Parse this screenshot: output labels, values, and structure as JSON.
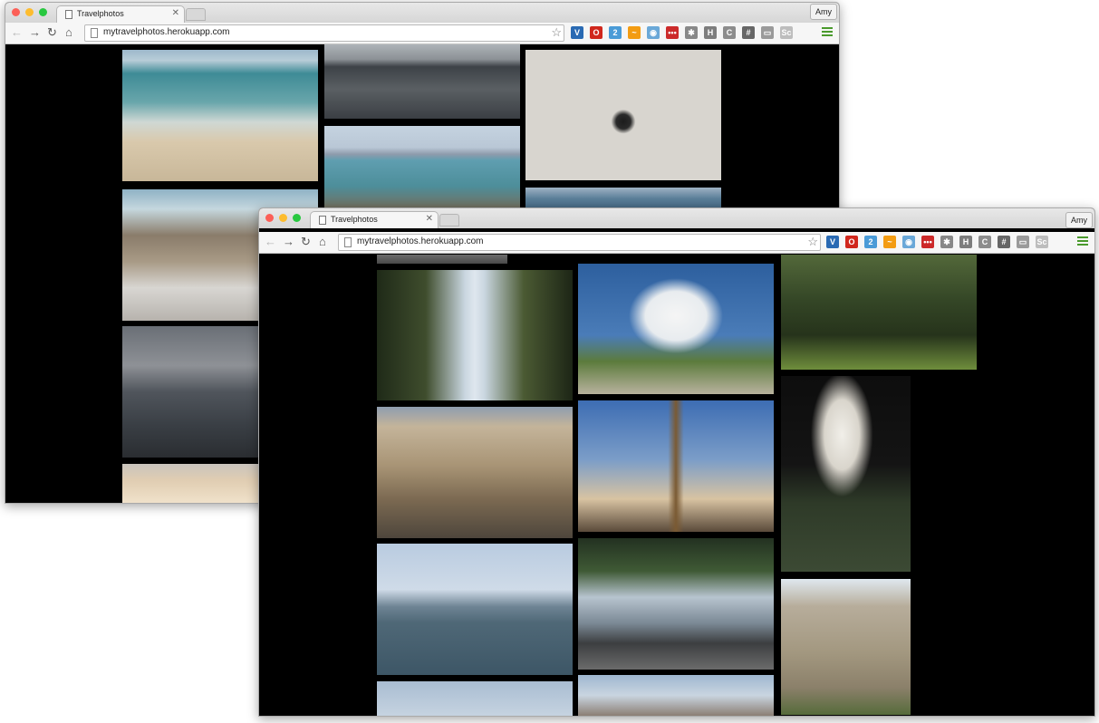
{
  "windows": [
    {
      "tab_title": "Travelphotos",
      "url": "mytravelphotos.herokuapp.com",
      "user": "Amy",
      "photos": [
        {
          "name": "photo-beach-penguins",
          "bg": "linear-gradient(180deg,#9db8cb 0%,#b8cdd8 8%,#3e8b96 18%,#69a6ab 40%,#cfd8d4 55%,#d9c9ac 70%,#c8b799 100%)"
        },
        {
          "name": "photo-ocean-grey",
          "bg": "linear-gradient(180deg,#aeb3b8 0%,#8c9196 20%,#3d4247 30%,#5a5f63 60%,#3b3f44 100%)"
        },
        {
          "name": "photo-penguin-sand",
          "bg": "radial-gradient(circle at 50% 55%,#1c1c1c 0%,#2a2a2a 6%,#d8d5cf 10%),linear-gradient(135deg,#e8e6e1,#bdbab4)"
        },
        {
          "name": "photo-rocks-shore",
          "bg": "linear-gradient(180deg,#8fb2c5 0%,#c5d7de 15%,#8a7c6a 35%,#a89a86 55%,#d8d6d2 75%,#b7b3ad 100%)"
        },
        {
          "name": "photo-ocean-mountains",
          "bg": "linear-gradient(180deg,#c5d3e0 0%,#b9c7d6 25%,#8e9bac 33%,#5f9eb0 40%,#4d8e9a 70%,#7a6a55 100%)"
        },
        {
          "name": "photo-dusk-sea",
          "bg": "linear-gradient(180deg,#6a6f76 0%,#8e9196 30%,#50555c 50%,#3a3f45 75%,#2a2d31 100%)"
        },
        {
          "name": "photo-sea-strip",
          "bg": "linear-gradient(180deg,#9fb2c3 0%,#5b7f99 40%,#3b5d78 100%)"
        },
        {
          "name": "photo-sunset-sky",
          "bg": "linear-gradient(180deg,#c9c4bd 0%,#e0cdb2 40%,#f1e3cc 100%)"
        }
      ]
    },
    {
      "tab_title": "Travelphotos",
      "url": "mytravelphotos.herokuapp.com",
      "user": "Amy",
      "photos": [
        {
          "name": "photo-top-strip",
          "bg": "linear-gradient(180deg,#6b6b6b,#4a4a4a)"
        },
        {
          "name": "photo-tree-avenue",
          "bg": "linear-gradient(90deg,#1f2a18 0%,#3f4d2d 25%,#c9d6e0 45%,#dfe7ee 50%,#c9d6e0 55%,#4b5a33 75%,#1d2616 100%)"
        },
        {
          "name": "photo-cloud-park",
          "bg": "radial-gradient(ellipse at 50% 40%,#f5f5f5 0%,#e8ecef 22%,rgba(0,0,0,0) 34%),linear-gradient(180deg,#2d5f9e 0%,#4a7cb8 55%,#5c7b3c 75%,#b8b29e 100%)"
        },
        {
          "name": "photo-garden-trees",
          "bg": "linear-gradient(180deg,#53683a 0%,#344626 40%,#26331b 70%,#6f8e3c 100%)"
        },
        {
          "name": "photo-soldiers-trocadero",
          "bg": "linear-gradient(180deg,#8f9db0 0%,#c4b49a 15%,#a89475 45%,#7c6a52 70%,#4e463c 100%)"
        },
        {
          "name": "photo-eiffel-tower",
          "bg": "linear-gradient(90deg,rgba(0,0,0,0) 46%,#7a5a33 50%,rgba(0,0,0,0) 54%),linear-gradient(180deg,#3d6db3 0%,#7b9dc8 45%,#d8c3a2 75%,#5a4a3a 100%)"
        },
        {
          "name": "photo-sacre-coeur",
          "bg": "radial-gradient(ellipse at 47% 30%,#f1efe9 0%,#d9d5cc 18%,rgba(0,0,0,0) 32%),linear-gradient(180deg,#0d0d0d 0%,#141414 45%,#2e3a28 65%,#3c4a34 100%)"
        },
        {
          "name": "photo-lake-boat",
          "bg": "linear-gradient(180deg,#b9cbe0 0%,#cfdbe8 35%,#6e8494 48%,#4f6877 60%,#3d5666 100%)"
        },
        {
          "name": "photo-statue-lakeside",
          "bg": "linear-gradient(180deg,#233121 0%,#3f5a35 25%,#b7c4cf 45%,#7a8894 65%,#3c3e40 80%,#6b6b6b 100%)"
        },
        {
          "name": "photo-building-facade",
          "bg": "linear-gradient(180deg,#dfe8ef 0%,#b7ad9b 20%,#a2977f 55%,#8b806a 80%,#566b3b 100%)"
        },
        {
          "name": "photo-sky-bottom-left",
          "bg": "linear-gradient(180deg,#a9bdd2,#c7d4e1)"
        },
        {
          "name": "photo-street-bottom-center",
          "bg": "linear-gradient(180deg,#9fb7d0 0%,#c9d5e0 50%,#8b7e74 100%)"
        }
      ]
    }
  ],
  "extensions": [
    {
      "name": "vivaldi-ext-icon",
      "label": "V",
      "color": "#2a6ab3"
    },
    {
      "name": "opera-ext-icon",
      "label": "O",
      "color": "#d0271c"
    },
    {
      "name": "badge-ext-icon",
      "label": "2",
      "color": "#4a9bd7"
    },
    {
      "name": "chart-ext-icon",
      "label": "~",
      "color": "#f39c12"
    },
    {
      "name": "camera-ext-icon",
      "label": "◉",
      "color": "#6aa8d8"
    },
    {
      "name": "lastpass-ext-icon",
      "label": "•••",
      "color": "#cc2a2a"
    },
    {
      "name": "puzzle-ext-icon",
      "label": "✱",
      "color": "#888888"
    },
    {
      "name": "h-ext-icon",
      "label": "H",
      "color": "#7d7d7d"
    },
    {
      "name": "c-ext-icon",
      "label": "C",
      "color": "#8c8c8c"
    },
    {
      "name": "grid-ext-icon",
      "label": "#",
      "color": "#666666"
    },
    {
      "name": "window-ext-icon",
      "label": "▭",
      "color": "#9a9a9a"
    },
    {
      "name": "sc-ext-icon",
      "label": "Sc",
      "color": "#bdbdbd"
    }
  ],
  "colors": {
    "close": "#fc5f57",
    "minimize": "#fdbc2e",
    "maximize": "#28c840"
  }
}
